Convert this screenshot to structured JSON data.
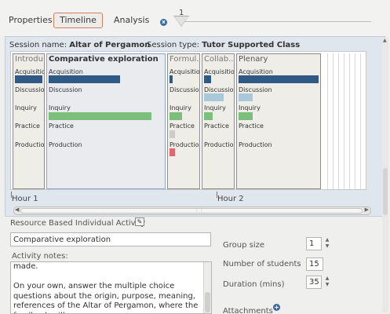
{
  "toolbar": {
    "tabs": [
      {
        "label": "Properties"
      },
      {
        "label": "Timeline"
      },
      {
        "label": "Analysis"
      }
    ],
    "close_glyph": "x",
    "zoom_value": "1"
  },
  "session": {
    "name_label": "Session name:",
    "name": "Altar of Pergamon",
    "type_label": "Session type:",
    "type": "Tutor Supported Class"
  },
  "timeline": {
    "colors": {
      "acquisition": "#2f5a85",
      "discussion": "#a9c9db",
      "inquiry": "#7cbf7c",
      "practice": "#cccccc",
      "production": "#e06671"
    },
    "activities": [
      {
        "title": "Introdu...",
        "phases": [
          "Acquisition",
          "Discussion",
          "Inquiry",
          "Practice",
          "Production"
        ],
        "levels": {
          "acquisition": 1.0,
          "discussion": 0,
          "inquiry": 0,
          "practice": 0,
          "production": 0
        }
      },
      {
        "title": "Comparative exploration",
        "phases": [
          "Acquisition",
          "Discussion",
          "Inquiry",
          "Practice",
          "Production"
        ],
        "levels": {
          "acquisition": 0.62,
          "discussion": 0,
          "inquiry": 0.9,
          "practice": 0,
          "production": 0
        }
      },
      {
        "title": "Formul...",
        "phases": [
          "Acquisition",
          "Discussion",
          "Inquiry",
          "Practice",
          "Production"
        ],
        "levels": {
          "acquisition": 0.1,
          "discussion": 0,
          "inquiry": 0.45,
          "practice": 0.2,
          "production": 0.2
        }
      },
      {
        "title": "Collab...",
        "phases": [
          "Acquisition",
          "Discussion",
          "Inquiry",
          "Practice",
          "Production"
        ],
        "levels": {
          "acquisition": 0.25,
          "discussion": 0.7,
          "inquiry": 0.3,
          "practice": 0,
          "production": 0
        }
      },
      {
        "title": "Plenary",
        "phases": [
          "Acquisition",
          "Discussion",
          "Inquiry",
          "Practice",
          "Production"
        ],
        "levels": {
          "acquisition": 1.0,
          "discussion": 0.18,
          "inquiry": 0.18,
          "practice": 0,
          "production": 0
        }
      }
    ],
    "hours": [
      "Hour 1",
      "Hour 2"
    ]
  },
  "activity": {
    "section_label": "Resource Based Individual Activity",
    "name_value": "Comparative exploration",
    "notes_label": "Activity notes:",
    "notes_text": "made.\n\nOn your own, answer the multiple choice questions about the origin, purpose, meaning, references of the Altar of Pergamon, where the feedback will",
    "group_size_label": "Group size",
    "group_size": "1",
    "students_label": "Number of students",
    "students": "15",
    "duration_label": "Duration (mins)",
    "duration": "35",
    "attachments_label": "Attachments"
  }
}
